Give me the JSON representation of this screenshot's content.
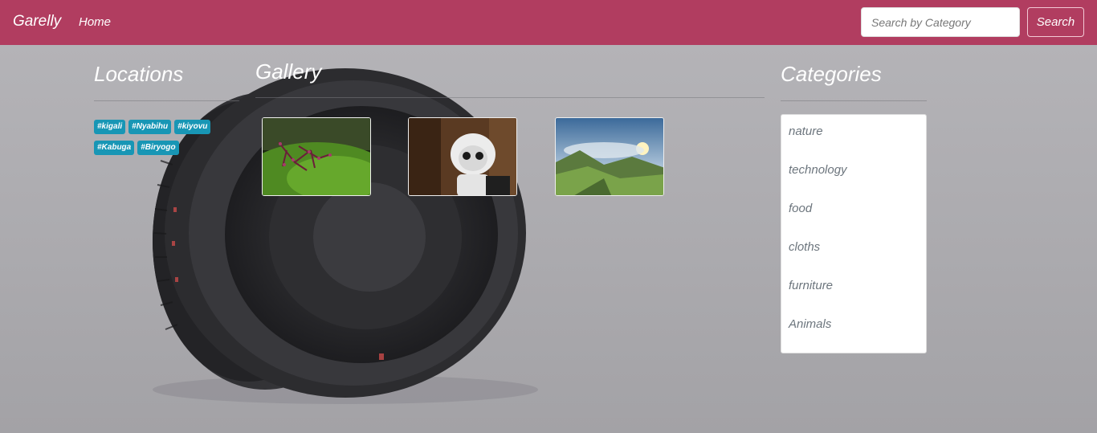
{
  "navbar": {
    "brand": "Garelly",
    "home_label": "Home",
    "search_placeholder": "Search by Category",
    "search_button": "Search",
    "color": "#b13d60"
  },
  "locations": {
    "title": "Locations",
    "tags": [
      "#kigali",
      "#Nyabihu",
      "#kiyovu",
      "#Kabuga",
      "#Biryogo"
    ],
    "tag_color": "#1896b5"
  },
  "gallery": {
    "title": "Gallery",
    "images": [
      {
        "name": "moss-plant-image"
      },
      {
        "name": "robot-image"
      },
      {
        "name": "mountain-landscape-image"
      }
    ]
  },
  "categories": {
    "title": "Categories",
    "items": [
      "nature",
      "technology",
      "food",
      "cloths",
      "furniture",
      "Animals"
    ]
  },
  "background": {
    "name": "camera-lens-background"
  }
}
